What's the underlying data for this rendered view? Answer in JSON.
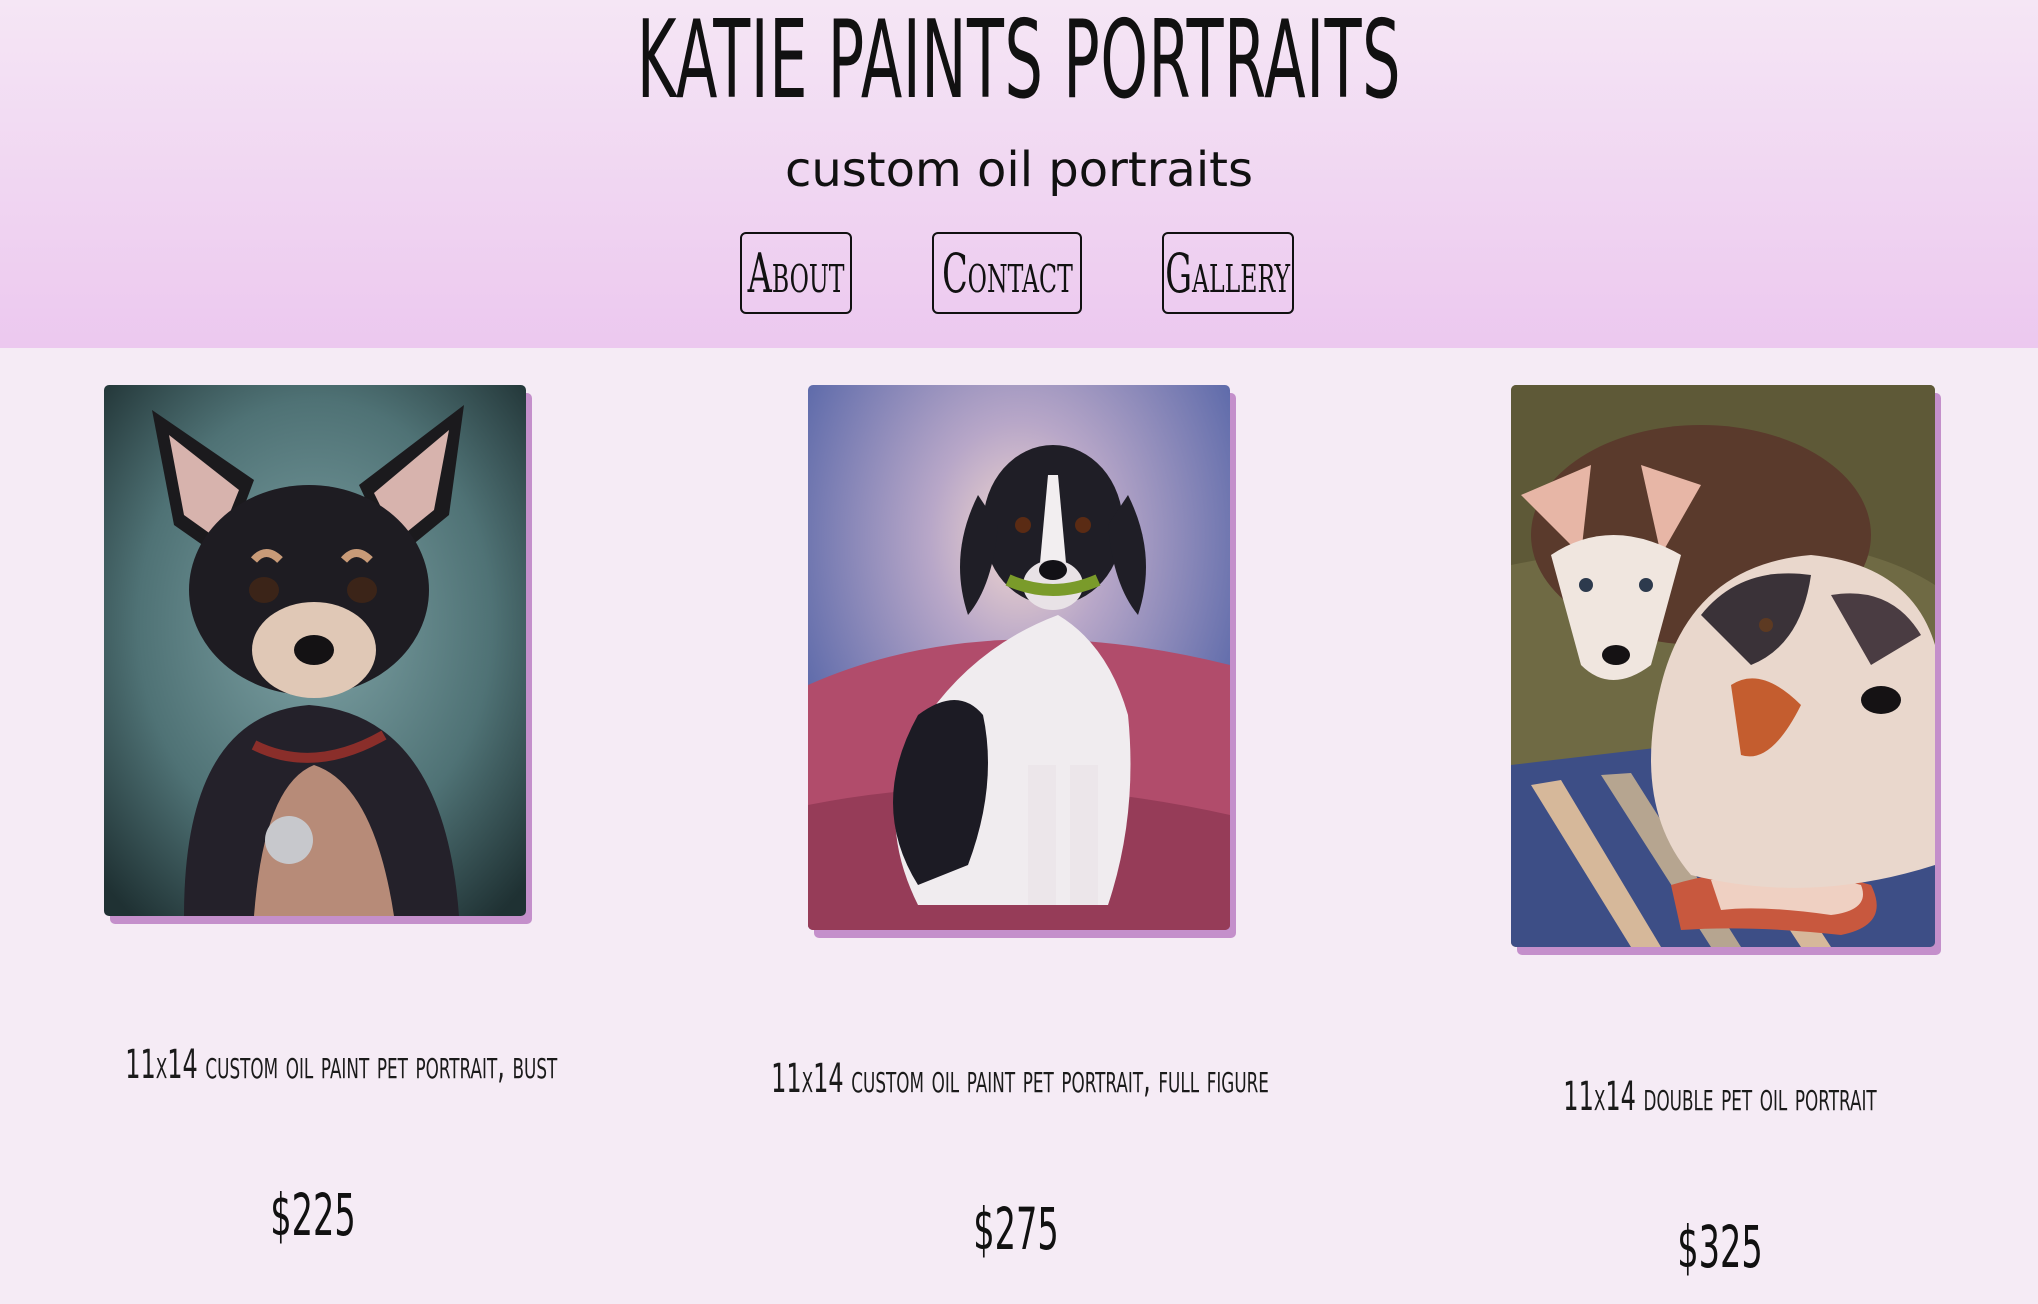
{
  "header": {
    "title": "KATIE PAINTS PORTRAITS",
    "subtitle": "custom oil portraits",
    "nav": [
      {
        "label": "About"
      },
      {
        "label": "Contact"
      },
      {
        "label": "Gallery"
      }
    ]
  },
  "products": [
    {
      "title": "11x14 custom oil paint pet portrait, bust",
      "price": "$225",
      "image": "chihuahua-portrait-painting"
    },
    {
      "title": "11x14 custom oil paint pet portrait, full figure",
      "price": "$275",
      "image": "beagle-portrait-painting"
    },
    {
      "title": "11x14 double pet oil portrait",
      "price": "$325",
      "image": "two-dogs-portrait-painting"
    }
  ],
  "colors": {
    "header_top": "#f5e6f5",
    "header_bottom": "#ecc8ef",
    "page_background": "#f5ebf5",
    "image_shadow": "#c48fcb"
  }
}
